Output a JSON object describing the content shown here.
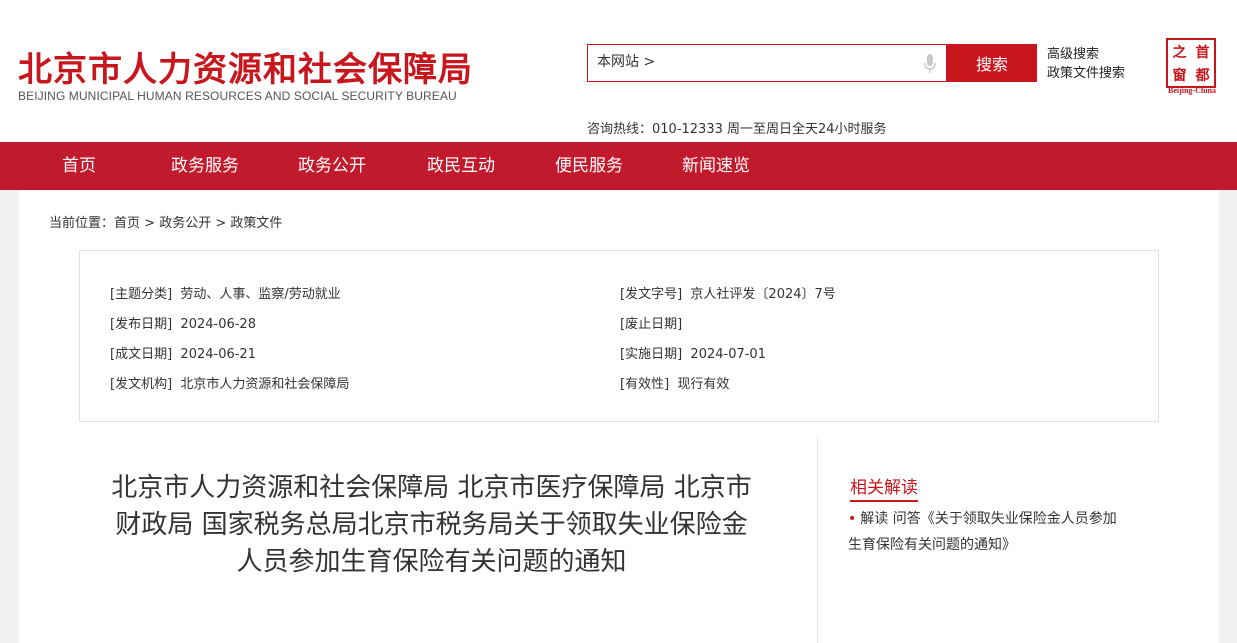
{
  "header": {
    "logo_cn": "北京市人力资源和社会保障局",
    "logo_en": "BEIJING MUNICIPAL HUMAN RESOURCES AND SOCIAL SECURITY BUREAU",
    "search_scope": "本网站 >",
    "search_button": "搜索",
    "advanced_search": "高级搜索",
    "policy_search": "政策文件搜索",
    "seal_chars": [
      "之",
      "首",
      "窗",
      "都"
    ],
    "seal_caption": "Beijing-China",
    "hotline": "咨询热线：010-12333 周一至周日全天24小时服务"
  },
  "nav": {
    "items": [
      "首页",
      "政务服务",
      "政务公开",
      "政民互动",
      "便民服务",
      "新闻速览"
    ]
  },
  "breadcrumb": {
    "label": "当前位置：",
    "items": [
      "首页",
      "政务公开",
      "政策文件"
    ],
    "separator": ">"
  },
  "meta": {
    "topic_label": "[主题分类]",
    "topic": "劳动、人事、监察/劳动就业",
    "doc_no_label": "[发文字号]",
    "doc_no": "京人社评发〔2024〕7号",
    "publish_label": "[发布日期]",
    "publish": "2024-06-28",
    "abolish_label": "[废止日期]",
    "abolish": "",
    "created_label": "[成文日期]",
    "created": "2024-06-21",
    "effective_label": "[实施日期]",
    "effective": "2024-07-01",
    "issuer_label": "[发文机构]",
    "issuer": "北京市人力资源和社会保障局",
    "validity_label": "[有效性]",
    "validity": "现行有效"
  },
  "document": {
    "title": "北京市人力资源和社会保障局 北京市医疗保障局 北京市财政局 国家税务总局北京市税务局关于领取失业保险金人员参加生育保险有关问题的通知"
  },
  "related": {
    "heading": "相关解读",
    "items": [
      {
        "text": "解读 问答《关于领取失业保险金人员参加生育保险有关问题的通知》"
      }
    ]
  },
  "colors": {
    "brand_red": "#c8161d",
    "nav_red": "#c21a2d"
  }
}
